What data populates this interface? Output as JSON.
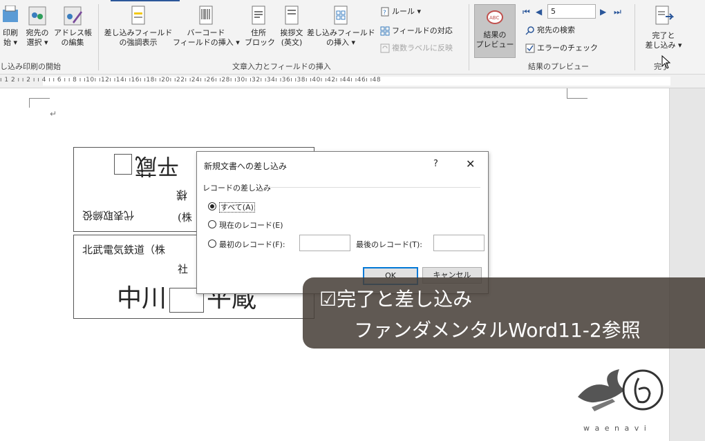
{
  "ribbon": {
    "start_group": {
      "print_label": "印刷",
      "print_sub": "始 ▾",
      "select_label": "宛先の",
      "select_sub": "選択 ▾",
      "edit_label": "アドレス帳",
      "edit_sub": "の編集",
      "group_label": "し込み印刷の開始"
    },
    "fields_group": {
      "highlight_label": "差し込みフィールド",
      "highlight_sub": "の強調表示",
      "barcode_label": "バーコード",
      "barcode_sub": "フィールドの挿入 ▾",
      "address_label": "住所",
      "address_sub": "ブロック",
      "greeting_label": "挨拶文",
      "greeting_sub": "(英文)",
      "insert_label": "差し込みフィールド",
      "insert_sub": "の挿入 ▾",
      "rules_label": "ルール ▾",
      "match_label": "フィールドの対応",
      "update_label": "複数ラベルに反映",
      "group_label": "文章入力とフィールドの挿入"
    },
    "preview_group": {
      "preview_label": "結果の",
      "preview_sub": "プレビュー",
      "record_value": "5",
      "find_label": "宛先の検索",
      "check_label": "エラーのチェック",
      "group_label": "結果のプレビュー"
    },
    "finish_group": {
      "finish_label": "完了と",
      "finish_sub": "差し込み ▾",
      "group_label": "完了"
    }
  },
  "ruler": {
    "ticks": "ı 1 2 ı   ı 2 ı   ı 4 ı   ı 6 ı   ı 8 ı   ı10ı   ı12ı   ı14ı   ı16ı   ı18ı   ı20ı   ı22ı   ı24ı   ı26ı   ı28ı   ı30ı   ı32ı   ı34ı   ı36ı   ı38ı   ı40ı   ı42ı   ı44ı   ı46ı   ı48"
  },
  "document": {
    "label1_name_flipped": "平蔵",
    "label1_title_flipped": "様",
    "label1_company_flipped": "代表取締役",
    "label1_company_prefix": "(株",
    "label2_company": "北武電気鉄道（株",
    "label2_title": "社",
    "label2_name": "中川",
    "label2_name_rest": "平蔵",
    "paragraph_mark": "↵"
  },
  "dialog": {
    "title": "新規文書への差し込み",
    "help": "?",
    "close": "✕",
    "section_label": "レコードの差し込み",
    "option_all": "すべて(A)",
    "option_current": "現在のレコード(E)",
    "option_from": "最初のレコード(F):",
    "to_label": "最後のレコード(T):",
    "ok": "OK",
    "cancel": "キャンセル"
  },
  "overlay": {
    "line1": "☑完了と差し込み",
    "line2": "ファンダメンタルWord11-2参照"
  },
  "logo": {
    "text": "w a e n a v i"
  }
}
